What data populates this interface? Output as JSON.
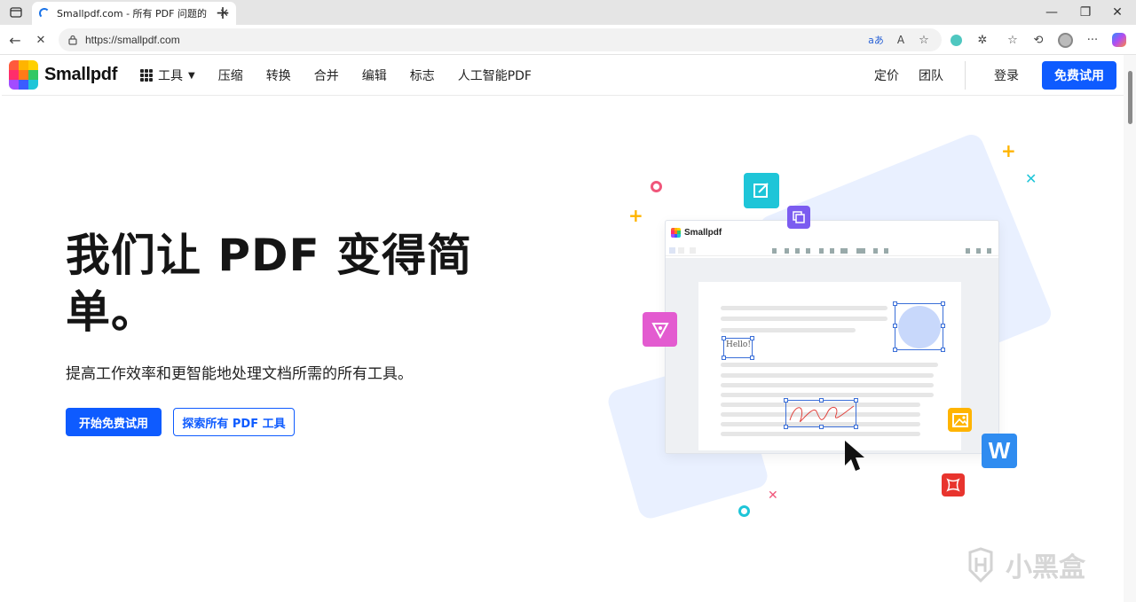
{
  "browser": {
    "tab_title": "Smallpdf.com - 所有 PDF 问题的",
    "url": "https://smallpdf.com"
  },
  "header": {
    "brand": "Smallpdf",
    "tools_label": "工具",
    "nav": [
      "压缩",
      "转换",
      "合并",
      "编辑",
      "标志",
      "人工智能PDF"
    ],
    "pricing": "定价",
    "team": "团队",
    "login": "登录",
    "free_trial": "免费试用"
  },
  "hero": {
    "title": "我们让 PDF 变得简单。",
    "subtitle": "提高工作效率和更智能地处理文档所需的所有工具。",
    "btn_start": "开始免费试用",
    "btn_explore": "探索所有 PDF 工具"
  },
  "illustration": {
    "app_name": "Smallpdf",
    "hello_text": "Hello!",
    "word_icon_letter": "W"
  },
  "watermark": {
    "text": "小黑盒"
  },
  "colors": {
    "primary": "#0e5bff",
    "text_dark": "#151515"
  }
}
